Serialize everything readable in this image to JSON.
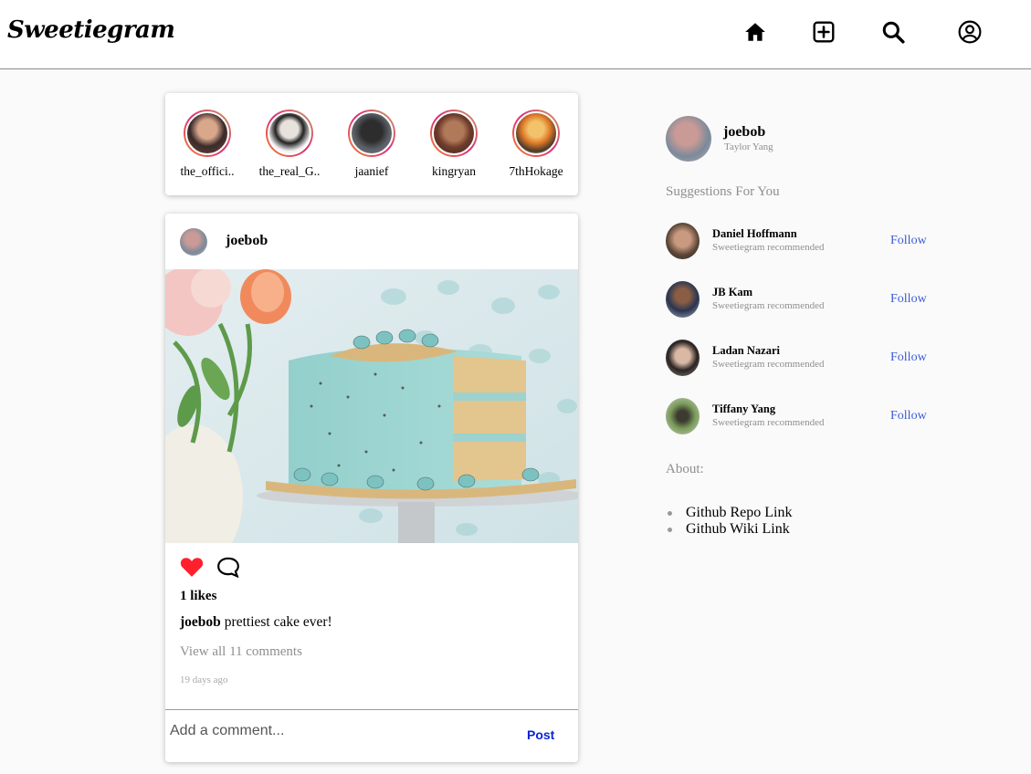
{
  "header": {
    "brand": "Sweetiegram",
    "icons": [
      "home-icon",
      "add-post-icon",
      "search-icon",
      "profile-icon"
    ]
  },
  "stories": [
    {
      "name": "the_offici.."
    },
    {
      "name": "the_real_G.."
    },
    {
      "name": "jaanief"
    },
    {
      "name": "kingryan"
    },
    {
      "name": "7thHokage"
    }
  ],
  "post": {
    "username": "joebob",
    "likes": "1 likes",
    "caption_user": "joebob",
    "caption_text": "prettiest cake ever!",
    "view_comments": "View all 11 comments",
    "time_ago": "19 days ago",
    "comment_placeholder": "Add a comment...",
    "post_button": "Post",
    "liked": true
  },
  "sidebar": {
    "username": "joebob",
    "full_name": "Taylor Yang",
    "suggestions_title": "Suggestions For You",
    "suggestions": [
      {
        "name": "Daniel Hoffmann",
        "subtitle": "Sweetiegram recommended",
        "action": "Follow"
      },
      {
        "name": "JB Kam",
        "subtitle": "Sweetiegram recommended",
        "action": "Follow"
      },
      {
        "name": "Ladan Nazari",
        "subtitle": "Sweetiegram recommended",
        "action": "Follow"
      },
      {
        "name": "Tiffany Yang",
        "subtitle": "Sweetiegram recommended",
        "action": "Follow"
      }
    ],
    "about_title": "About:",
    "links": [
      "Github Repo Link",
      "Github Wiki Link"
    ]
  },
  "colors": {
    "like": "#ff1f2d",
    "follow": "#3b5bd6",
    "post_button": "#0a23d6",
    "muted": "#8e8e8e"
  }
}
